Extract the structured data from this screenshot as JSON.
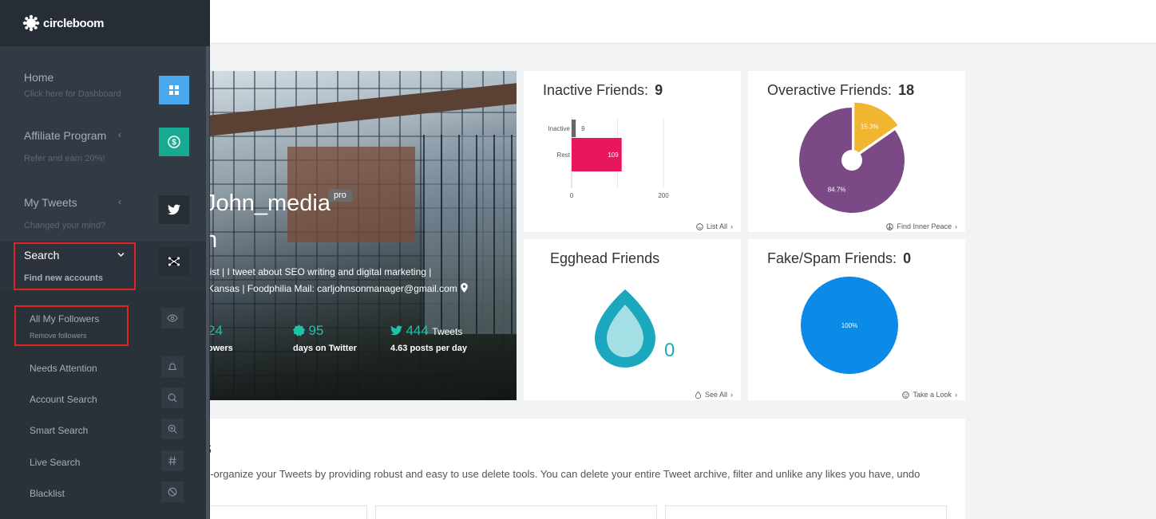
{
  "app": {
    "logo_text": "circleboom"
  },
  "sidebar": {
    "home": {
      "label": "Home",
      "sub": "Click here for Dashboard",
      "icon": "dashboard-grid-icon"
    },
    "affiliate": {
      "label": "Affiliate Program",
      "sub": "Refer and earn 20%!",
      "icon": "dollar-circle-icon"
    },
    "tweets": {
      "label": "My Tweets",
      "sub": "Changed your mind?",
      "icon": "twitter-bird-icon"
    },
    "search": {
      "label": "Search",
      "sub": "Find new accounts",
      "icon": "network-icon"
    },
    "submenu": [
      {
        "label": "All My Followers",
        "sub": "Remove followers",
        "icon": "eye-icon"
      },
      {
        "label": "Needs Attention",
        "icon": "bell-icon"
      },
      {
        "label": "Account Search",
        "icon": "search-icon"
      },
      {
        "label": "Smart Search",
        "icon": "zoom-in-icon"
      },
      {
        "label": "Live Search",
        "icon": "hashtag-icon"
      },
      {
        "label": "Blacklist",
        "icon": "ban-icon"
      }
    ]
  },
  "profile": {
    "username": "John_media",
    "badge": "pro",
    "name": "n",
    "bio_line1": "list | I tweet about SEO writing and digital marketing |",
    "bio_line2": "Kansas | Foodphilia Mail: carljohnsonmanager@gmail.com",
    "stats": {
      "followers_num": "24",
      "followers_label": "owers",
      "days_num": "95",
      "days_label": "days on Twitter",
      "tweets_num": "444",
      "tweets_suffix": "Tweets",
      "tweets_label": "4.63 posts per day"
    }
  },
  "widgets": {
    "inactive": {
      "title": "Inactive Friends:",
      "count": "9",
      "link": "List All",
      "chart_data": {
        "type": "bar",
        "orientation": "horizontal",
        "categories": [
          "Inactive",
          "Rest"
        ],
        "values": [
          9,
          109
        ],
        "value_labels": [
          "9",
          "109"
        ],
        "xlim": [
          0,
          200
        ],
        "x_ticks": [
          "0",
          "200"
        ],
        "colors": [
          "#666666",
          "#e8175d"
        ]
      }
    },
    "overactive": {
      "title": "Overactive Friends:",
      "count": "18",
      "link": "Find Inner Peace",
      "chart_data": {
        "type": "pie",
        "values": [
          15.3,
          84.7
        ],
        "labels": [
          "15.3%",
          "84.7%"
        ],
        "colors": [
          "#f0b62f",
          "#7b4a86"
        ]
      }
    },
    "egghead": {
      "title": "Egghead Friends",
      "count": "0",
      "link": "See All",
      "colors": {
        "outer": "#1ba8bf",
        "inner": "#a4dfe6"
      }
    },
    "fake": {
      "title": "Fake/Spam Friends:",
      "count": "0",
      "link": "Take a Look",
      "chart_data": {
        "type": "pie",
        "values": [
          100
        ],
        "labels": [
          "100%"
        ],
        "colors": [
          "#0c8ae8"
        ]
      }
    }
  },
  "section": {
    "title": "s",
    "text": "e-organize your Tweets by providing robust and easy to use delete tools. You can delete your entire Tweet archive, filter and unlike any likes you have, undo"
  },
  "colors": {
    "sidebar_bg": "#323a44",
    "accent_teal": "#1fc2a7",
    "highlight_red": "#e02424"
  }
}
